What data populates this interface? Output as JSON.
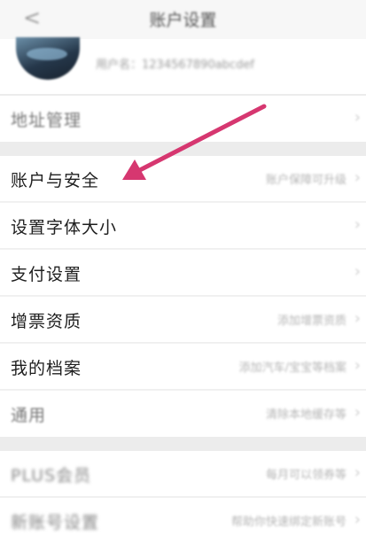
{
  "header": {
    "back_icon": "chevron-left-icon",
    "title": "账户设置"
  },
  "profile": {
    "subtitle": "用户名：1234567890abcdef"
  },
  "rows": [
    {
      "label": "地址管理",
      "value": ""
    },
    {
      "label": "账户与安全",
      "value": "账户保障可升级"
    },
    {
      "label": "设置字体大小",
      "value": ""
    },
    {
      "label": "支付设置",
      "value": ""
    },
    {
      "label": "增票资质",
      "value": "添加增票资质"
    },
    {
      "label": "我的档案",
      "value": "添加汽车/宝宝等档案"
    },
    {
      "label": "通用",
      "value": "清除本地缓存等"
    },
    {
      "label": "PLUS会员",
      "value": "每月可以领券等"
    },
    {
      "label": "新账号设置",
      "value": "帮助你快速绑定新账号"
    }
  ],
  "annotation": {
    "arrow_color": "#d63770"
  }
}
